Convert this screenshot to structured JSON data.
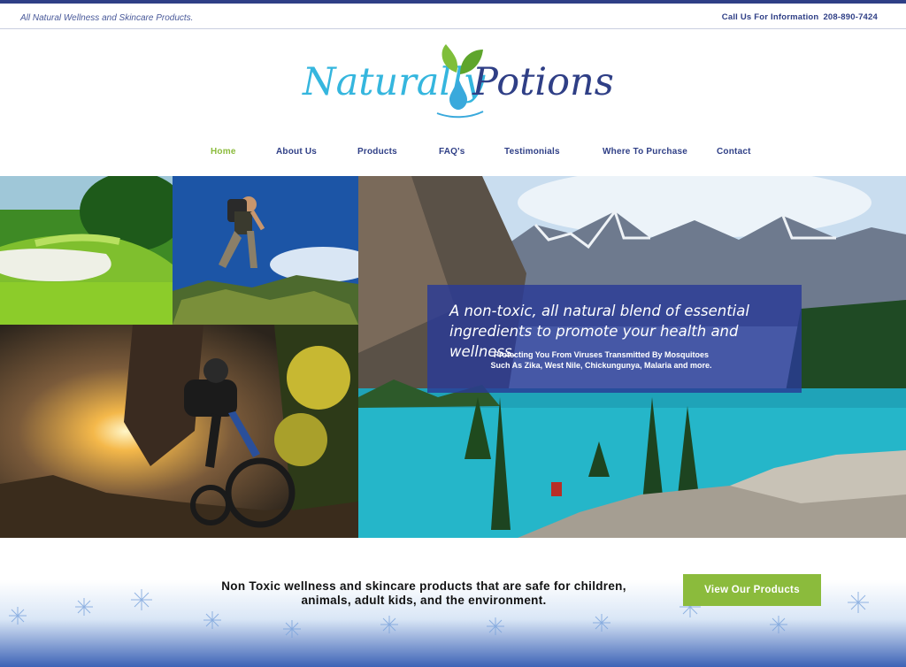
{
  "topbar": {
    "tagline": "All Natural Wellness and Skincare Products.",
    "call_label": "Call Us For Information",
    "phone": "208-890-7424"
  },
  "logo": {
    "word_left": "Naturally",
    "word_right": "Potions"
  },
  "nav": {
    "items": [
      {
        "label": "Home",
        "active": true
      },
      {
        "label": "About Us"
      },
      {
        "label": "Products"
      },
      {
        "label": "FAQ's"
      },
      {
        "label": "Testimonials"
      },
      {
        "label": "Where To Purchase"
      },
      {
        "label": "Contact"
      }
    ]
  },
  "hero": {
    "title": "A non-toxic, all natural blend of essential ingredients to promote your health and wellness.",
    "sub_line1": "Protecting You From Viruses Transmitted By Mosquitoes",
    "sub_line2": "Such As Zika, West Nile, Chickungunya, Malaria and more."
  },
  "bottom": {
    "text_line1": "Non Toxic wellness and skincare products that are safe for children,",
    "text_line2": "animals, adult kids, and the environment.",
    "cta_label": "View Our Products"
  },
  "colors": {
    "navy": "#2f3f86",
    "accent_green": "#8bbb3c",
    "logo_blue": "#35b6de"
  }
}
